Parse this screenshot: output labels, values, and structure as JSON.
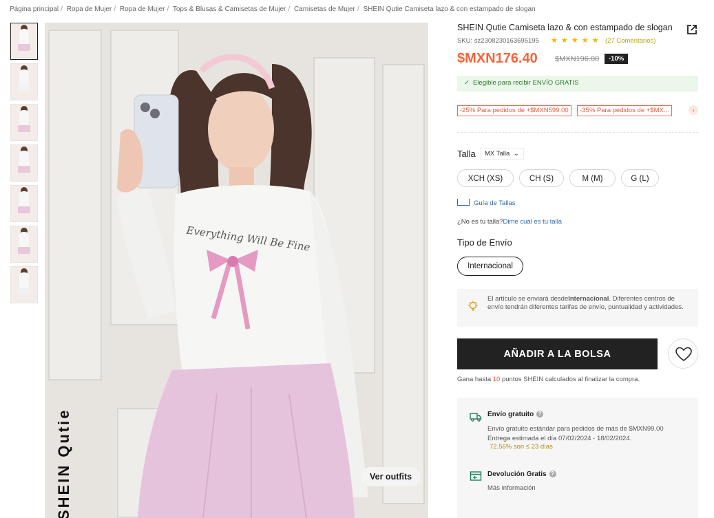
{
  "breadcrumb": [
    "Página principal",
    "Ropa de Mujer",
    "Ropa de Mujer",
    "Tops & Blusas & Camisetas de Mujer",
    "Camisetas de Mujer",
    "SHEIN Qutie Camiseta lazo & con estampado de slogan"
  ],
  "product": {
    "title": "SHEIN Qutie Camiseta lazo & con estampado de slogan",
    "sku": "SKU: sz2308230163695195",
    "stars": "★ ★ ★ ★ ★",
    "reviews": "(27 Comentarios)",
    "price": "$MXN176.40",
    "old_price": "$MXN196.00",
    "discount": "-10%",
    "free_shipping": "Elegible para recibir ENVÍO GRATIS"
  },
  "coupons": [
    "-25% Para pedidos de +$MXN599.00",
    "-35% Para pedidos de +$MX..."
  ],
  "photo": {
    "ver_outfits": "Ver outfits",
    "brand_text": "SHEIN Qutie",
    "shirt_text": "Everything Will Be Fine"
  },
  "size": {
    "label": "Talla",
    "selector": "MX Talla",
    "options": [
      "XCH (XS)",
      "CH (S)",
      "M (M)",
      "G (L)"
    ],
    "guide": "Guía de Tallas",
    "not_your_size": "¿No es tu talla?",
    "not_your_size_link": "Dime cuál es tu talla"
  },
  "shipping_type": {
    "label": "Tipo de Envío",
    "option": "Internacional"
  },
  "notice": {
    "text_a": "El artículo se enviará desde",
    "text_bold": "Internacional",
    "text_b": ". Diferentes centros de envío tendrán diferentes tarifas de envío, puntualidad y actividades."
  },
  "actions": {
    "add_to_bag": "AÑADIR A LA BOLSA",
    "points_a": "Gana hasta ",
    "points_num": "10",
    "points_b": " puntos SHEIN calculados al finalizar la compra."
  },
  "shipping_info": {
    "title": "Envío gratuito",
    "line1": "Envío gratuito estándar para pedidos de más de $MXN99.00",
    "line2": "Entrega estimada el día 07/02/2024 - 18/02/2024.",
    "pct": "72.56% son ≤ 23 días",
    "return_title": "Devolución Gratis",
    "return_more": "Más información"
  },
  "colors": {
    "price": "#fa6338",
    "button": "#222222",
    "skirt": "#e6c3dc",
    "link": "#2d68a8"
  }
}
